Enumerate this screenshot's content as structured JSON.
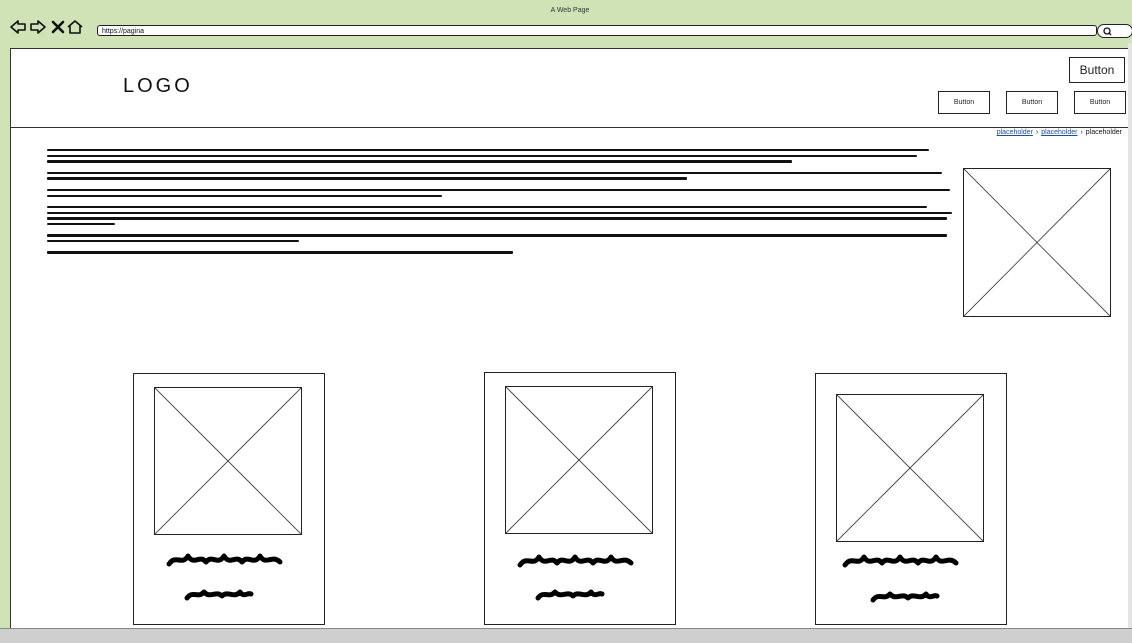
{
  "window": {
    "title": "A Web Page",
    "url": "https://pagina"
  },
  "header": {
    "logo": "LOGO",
    "primary_button": "Button",
    "nav_buttons": [
      "Button",
      "Button",
      "Button"
    ]
  },
  "breadcrumb": {
    "items": [
      "placeholder",
      "placeholder",
      "placeholder"
    ],
    "separator": "›"
  },
  "icons": [
    "back-arrow-icon",
    "forward-arrow-icon",
    "close-icon",
    "home-icon",
    "search-icon"
  ],
  "colors": {
    "background": "#cfe3b7",
    "link": "#1a4fa0"
  }
}
